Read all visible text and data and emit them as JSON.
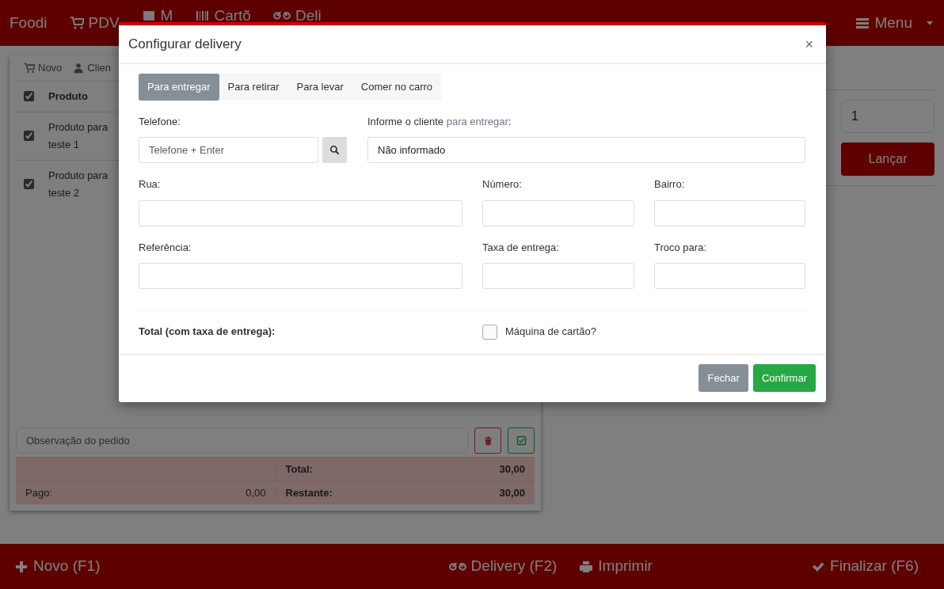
{
  "navbar": {
    "brand": "Foodi",
    "items": [
      {
        "label": "PDV"
      },
      {
        "label": "M"
      },
      {
        "label": "Cartõ"
      },
      {
        "label": "Deli"
      }
    ],
    "menu": "Menu"
  },
  "order_panel": {
    "toolbar": [
      {
        "label": "Novo"
      },
      {
        "label": "Clien"
      }
    ],
    "header": {
      "checked": true,
      "label": "Produto"
    },
    "rows": [
      {
        "checked": true,
        "product": "Produto para teste 1"
      },
      {
        "checked": true,
        "product": "Produto para teste 2"
      }
    ],
    "observation": {
      "placeholder": "Observação do pedido"
    },
    "summary": [
      {
        "label2": "Total:",
        "value2": "30,00"
      },
      {
        "label": "Pago:",
        "value": "0,00",
        "label2": "Restante:",
        "value2": "30,00"
      }
    ]
  },
  "launch_panel": {
    "quantity": "1",
    "button": "Lançar"
  },
  "footer": {
    "left": {
      "label": "Novo (F1)"
    },
    "center": [
      {
        "label": "Delivery (F2)"
      },
      {
        "label": "Imprimir"
      }
    ],
    "right": {
      "label": "Finalizar (F6)"
    }
  },
  "modal": {
    "title": "Configurar delivery",
    "close": "×",
    "tabs": [
      {
        "label": "Para entregar",
        "selected": true
      },
      {
        "label": "Para retirar",
        "selected": false
      },
      {
        "label": "Para levar",
        "selected": false
      },
      {
        "label": "Comer no carro",
        "selected": false
      }
    ],
    "phone": {
      "label": "Telefone:",
      "placeholder": "Telefone + Enter"
    },
    "client": {
      "label": "Informe o cliente ",
      "label_highlight": "para entregar",
      "label_end": ":",
      "value": "Não informado"
    },
    "fields": [
      {
        "label": "Rua:"
      },
      {
        "label": "Número:"
      },
      {
        "label": "Bairro:"
      },
      {
        "label": "Referência:"
      },
      {
        "label": "Taxa de entrega:"
      },
      {
        "label": "Troco para:"
      }
    ],
    "total_label": "Total (com taxa de entrega):",
    "card_machine": {
      "label": "Máquina de cartão?",
      "checked": false
    },
    "buttons": [
      {
        "label": "Fechar",
        "kind": "secondary"
      },
      {
        "label": "Confirmar",
        "kind": "success"
      }
    ]
  }
}
